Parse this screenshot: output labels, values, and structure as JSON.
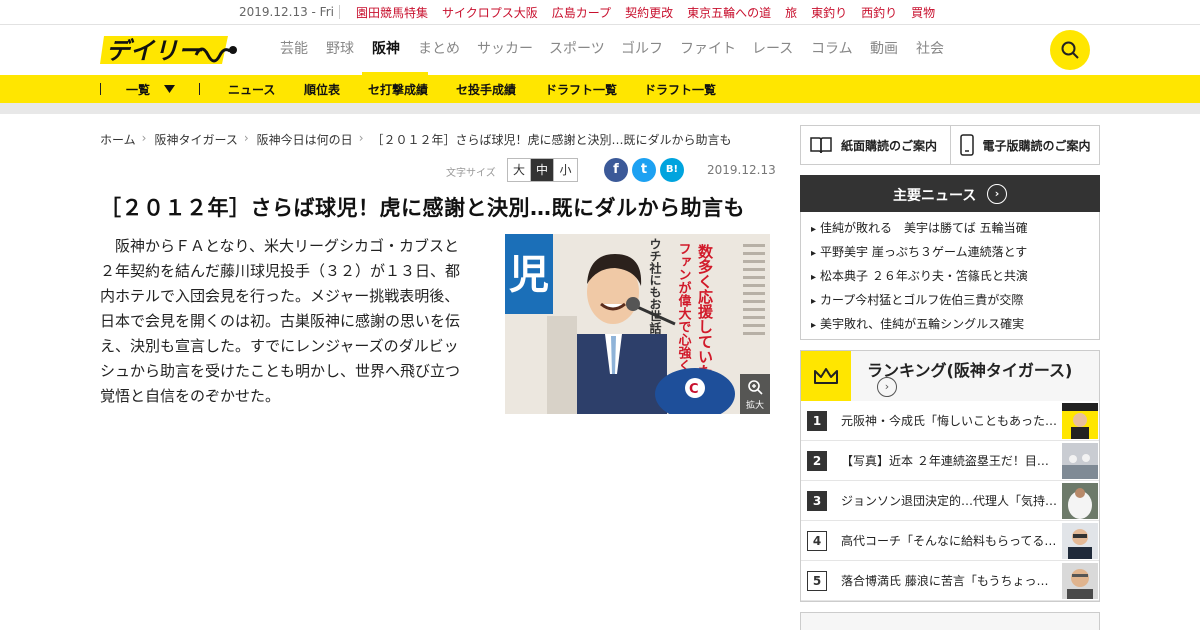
{
  "topbar": {
    "date": "2019.12.13 - Fri",
    "links": [
      "園田競馬特集",
      "サイクロプス大阪",
      "広島カープ",
      "契約更改",
      "東京五輪への道",
      "旅",
      "東釣り",
      "西釣り",
      "買物"
    ]
  },
  "header": {
    "logo_text": "デイリー",
    "nav": [
      "芸能",
      "野球",
      "阪神",
      "まとめ",
      "サッカー",
      "スポーツ",
      "ゴルフ",
      "ファイト",
      "レース",
      "コラム",
      "動画",
      "社会"
    ],
    "active_nav": "阪神"
  },
  "subnav": {
    "dropdown_label": "一覧",
    "items": [
      "ニュース",
      "順位表",
      "セ打撃成績",
      "セ投手成績",
      "ドラフト一覧",
      "ドラフト一覧"
    ]
  },
  "breadcrumb": [
    "ホーム",
    "阪神タイガース",
    "阪神今日は何の日",
    "［２０１２年］さらば球児！虎に感謝と決別…既にダルから助言も"
  ],
  "font_size": {
    "label": "文字サイズ",
    "options": [
      "大",
      "中",
      "小"
    ],
    "selected": "中"
  },
  "share": {
    "facebook": "f",
    "twitter": "t",
    "hatena": "B!"
  },
  "article": {
    "date": "2019.12.13",
    "title": "［２０１２年］さらば球児！虎に感謝と決別…既にダルから助言も",
    "body": "阪神からＦＡとなり、米大リーグシカゴ・カブスと２年契約を結んだ藤川球児投手（３２）が１３日、都内ホテルで入団会見を行った。メジャー挑戦表明後、日本で会見を開くのは初。古巣阪神に感謝の思いを伝え、決別も宣言した。すでにレンジャーズのダルビッシュから助言を受けたことも明かし、世界へ飛び立つ覚悟と自信をのぞかせた。",
    "zoom_label": "拡大",
    "photo_headlines": [
      "児",
      "数多く応援していただいた",
      "ファンが偉大で心強く",
      "ウチ社にもお世話になり"
    ]
  },
  "sidebar": {
    "subscribe": [
      "紙面購読のご案内",
      "電子版購読のご案内"
    ],
    "news_title": "主要ニュース",
    "news": [
      "佳純が敗れる　美宇は勝てば 五輪当確",
      "平野美宇 崖っぷち３ゲーム連続落とす",
      "松本典子 ２６年ぶり夫・笘篠氏と共演",
      "カープ今村猛とゴルフ佐伯三貴が交際",
      "美宇敗れ、佳純が五輪シングルス確実"
    ],
    "ranking_title": "ランキング(阪神タイガース)",
    "ranking": [
      {
        "rank": "1",
        "text": "元阪神・今成氏「悔しいこともあった…"
      },
      {
        "rank": "2",
        "text": "【写真】近本 ２年連続盗塁王だ！目…"
      },
      {
        "rank": "3",
        "text": "ジョンソン退団決定的…代理人「気持…"
      },
      {
        "rank": "4",
        "text": "高代コーチ「そんなに給料もらってる…"
      },
      {
        "rank": "5",
        "text": "落合博満氏 藤浪に苦言「もうちょっ…"
      }
    ]
  },
  "colors": {
    "brand_yellow": "#ffe600",
    "link_red": "#c8102e",
    "facebook": "#3b5998",
    "twitter": "#1da1f2",
    "hatena": "#00a4de",
    "dark_header": "#333333"
  }
}
